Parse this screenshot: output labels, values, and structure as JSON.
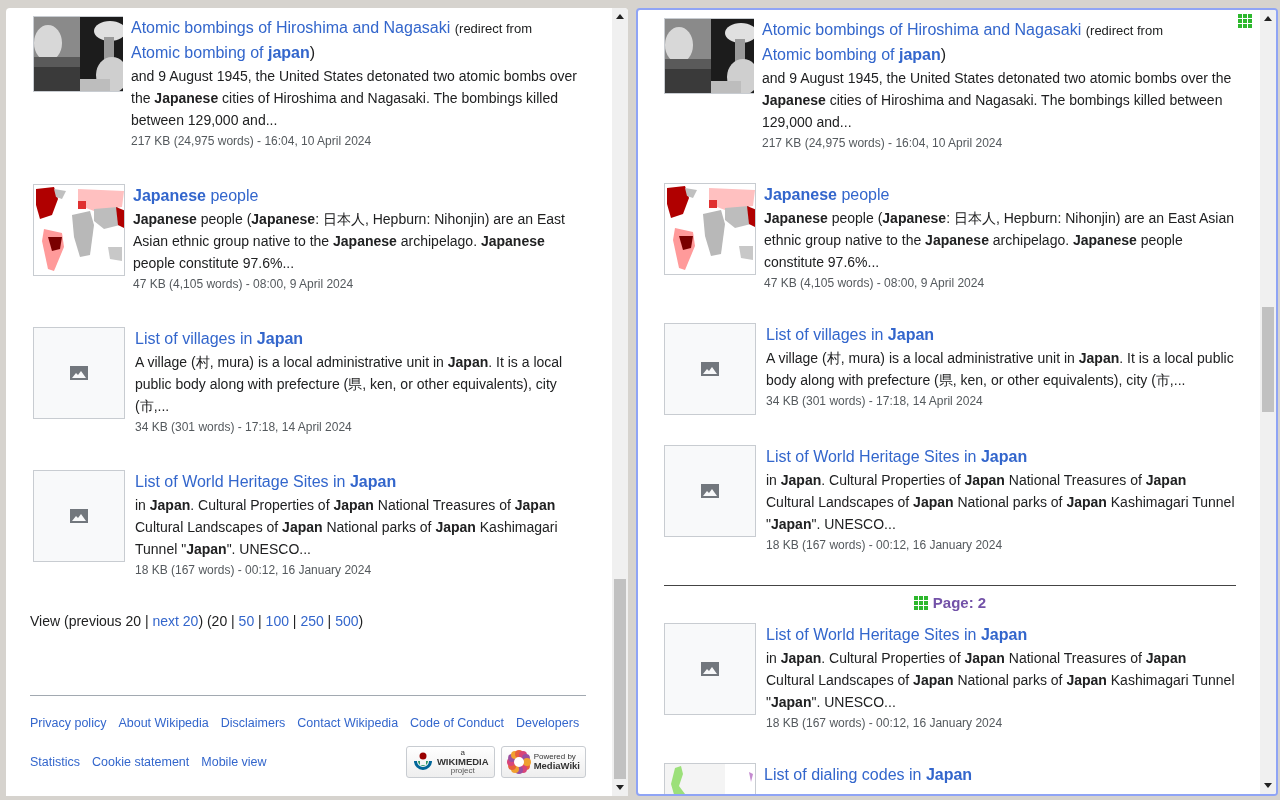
{
  "left_pane": {
    "results": [
      {
        "title": "Atomic bombings of Hiroshima and Nagasaki",
        "redirect": {
          "prefix": "(redirect from",
          "link": "Atomic bombing of **japan**",
          "suffix": ")"
        },
        "snippet": "and 9 August 1945, the United States detonated two atomic bombs over the **Japanese** cities of Hiroshima and Nagasaki. The bombings killed between 129,000 and...",
        "meta": "217 KB (24,975 words) - 16:04, 10 April 2024"
      },
      {
        "kind": "map",
        "title": "**Japanese** people",
        "snippet": "**Japanese** people (**Japanese**: 日本人, Hepburn: Nihonjin) are an East Asian ethnic group native to the **Japanese** archipelago. **Japanese** people constitute 97.6%...",
        "meta": "47 KB (4,105 words) - 08:00, 9 April 2024"
      },
      {
        "kind": "placeholder",
        "title": "List of villages in **Japan**",
        "snippet": "A village (村, mura) is a local administrative unit in **Japan**. It is a local public body along with prefecture (県, ken, or other equivalents), city (市,...",
        "meta": "34 KB (301 words) - 17:18, 14 April 2024"
      },
      {
        "kind": "placeholder",
        "title": "List of World Heritage Sites in **Japan**",
        "snippet": "in **Japan**. Cultural Properties of **Japan** National Treasures of **Japan** Cultural Landscapes of **Japan** National parks of **Japan** Kashimagari Tunnel \"**Japan**\". UNESCO...",
        "meta": "18 KB (167 words) - 00:12, 16 January 2024"
      }
    ],
    "pager": [
      {
        "text": "View (previous 20 | ",
        "link": false
      },
      {
        "text": "next 20",
        "link": true
      },
      {
        "text": ") (20 | ",
        "link": false
      },
      {
        "text": "50",
        "link": true
      },
      {
        "text": " | ",
        "link": false
      },
      {
        "text": "100",
        "link": true
      },
      {
        "text": " | ",
        "link": false
      },
      {
        "text": "250",
        "link": true
      },
      {
        "text": " | ",
        "link": false
      },
      {
        "text": "500",
        "link": true
      },
      {
        "text": ")",
        "link": false
      }
    ],
    "footer_links": [
      [
        "Privacy policy",
        "About Wikipedia",
        "Disclaimers",
        "Contact Wikipedia",
        "Code of Conduct",
        "Developers"
      ],
      [
        "Statistics",
        "Cookie statement",
        "Mobile view"
      ]
    ],
    "badges": [
      {
        "kind": "wikimedia",
        "small": "a",
        "big": "WIKIMEDIA",
        "sub": "project"
      },
      {
        "kind": "mediawiki",
        "small": "Powered by",
        "big": "MediaWiki"
      }
    ]
  },
  "right_pane": {
    "results": [
      {
        "title": "Atomic bombings of Hiroshima and Nagasaki",
        "redirect": {
          "prefix": "(redirect from",
          "link": "Atomic bombing of **japan**",
          "suffix": ")"
        },
        "snippet": "and 9 August 1945, the United States detonated two atomic bombs over the **Japanese** cities of Hiroshima and Nagasaki. The bombings killed between 129,000 and...",
        "meta": "217 KB (24,975 words) - 16:04, 10 April 2024"
      },
      {
        "kind": "map",
        "title": "**Japanese** people",
        "snippet": "**Japanese** people (**Japanese**: 日本人, Hepburn: Nihonjin) are an East Asian ethnic group native to the **Japanese** archipelago. **Japanese** people constitute 97.6%...",
        "meta": "47 KB (4,105 words) - 08:00, 9 April 2024"
      },
      {
        "kind": "placeholder",
        "title": "List of villages in **Japan**",
        "snippet": "A village (村, mura) is a local administrative unit in **Japan**. It is a local public body along with prefecture (県, ken, or other equivalents), city (市,...",
        "meta": "34 KB (301 words) - 17:18, 14 April 2024"
      },
      {
        "kind": "placeholder",
        "title": "List of World Heritage Sites in **Japan**",
        "snippet": "in **Japan**. Cultural Properties of **Japan** National Treasures of **Japan** Cultural Landscapes of **Japan** National parks of **Japan** Kashimagari Tunnel \"**Japan**\". UNESCO...",
        "meta": "18 KB (167 words) - 00:12, 16 January 2024"
      }
    ],
    "page_marker": "Page: 2",
    "page2_results": [
      {
        "kind": "placeholder",
        "title": "List of World Heritage Sites in **Japan**",
        "snippet": "in **Japan**. Cultural Properties of **Japan** National Treasures of **Japan** Cultural Landscapes of **Japan** National parks of **Japan** Kashimagari Tunnel \"**Japan**\". UNESCO...",
        "meta": "18 KB (167 words) - 00:12, 16 January 2024"
      },
      {
        "kind": "partial",
        "title": "List of dialing codes in **Japan**"
      }
    ]
  }
}
